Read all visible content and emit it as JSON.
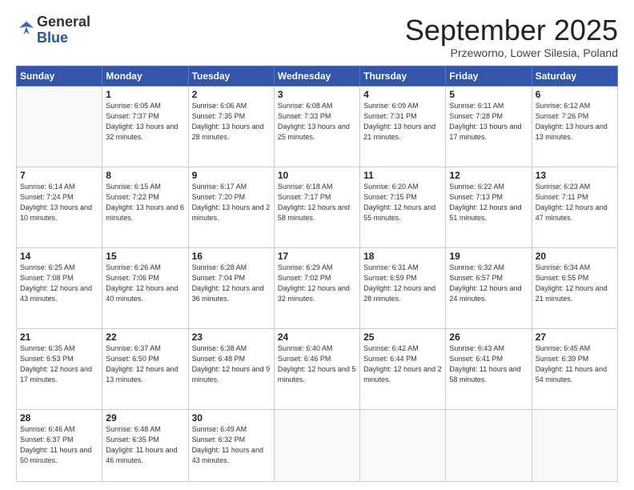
{
  "logo": {
    "general": "General",
    "blue": "Blue"
  },
  "header": {
    "month": "September 2025",
    "location": "Przeworno, Lower Silesia, Poland"
  },
  "weekdays": [
    "Sunday",
    "Monday",
    "Tuesday",
    "Wednesday",
    "Thursday",
    "Friday",
    "Saturday"
  ],
  "weeks": [
    [
      {
        "day": "",
        "sunrise": "",
        "sunset": "",
        "daylight": ""
      },
      {
        "day": "1",
        "sunrise": "Sunrise: 6:05 AM",
        "sunset": "Sunset: 7:37 PM",
        "daylight": "Daylight: 13 hours and 32 minutes."
      },
      {
        "day": "2",
        "sunrise": "Sunrise: 6:06 AM",
        "sunset": "Sunset: 7:35 PM",
        "daylight": "Daylight: 13 hours and 28 minutes."
      },
      {
        "day": "3",
        "sunrise": "Sunrise: 6:08 AM",
        "sunset": "Sunset: 7:33 PM",
        "daylight": "Daylight: 13 hours and 25 minutes."
      },
      {
        "day": "4",
        "sunrise": "Sunrise: 6:09 AM",
        "sunset": "Sunset: 7:31 PM",
        "daylight": "Daylight: 13 hours and 21 minutes."
      },
      {
        "day": "5",
        "sunrise": "Sunrise: 6:11 AM",
        "sunset": "Sunset: 7:28 PM",
        "daylight": "Daylight: 13 hours and 17 minutes."
      },
      {
        "day": "6",
        "sunrise": "Sunrise: 6:12 AM",
        "sunset": "Sunset: 7:26 PM",
        "daylight": "Daylight: 13 hours and 13 minutes."
      }
    ],
    [
      {
        "day": "7",
        "sunrise": "Sunrise: 6:14 AM",
        "sunset": "Sunset: 7:24 PM",
        "daylight": "Daylight: 13 hours and 10 minutes."
      },
      {
        "day": "8",
        "sunrise": "Sunrise: 6:15 AM",
        "sunset": "Sunset: 7:22 PM",
        "daylight": "Daylight: 13 hours and 6 minutes."
      },
      {
        "day": "9",
        "sunrise": "Sunrise: 6:17 AM",
        "sunset": "Sunset: 7:20 PM",
        "daylight": "Daylight: 13 hours and 2 minutes."
      },
      {
        "day": "10",
        "sunrise": "Sunrise: 6:18 AM",
        "sunset": "Sunset: 7:17 PM",
        "daylight": "Daylight: 12 hours and 58 minutes."
      },
      {
        "day": "11",
        "sunrise": "Sunrise: 6:20 AM",
        "sunset": "Sunset: 7:15 PM",
        "daylight": "Daylight: 12 hours and 55 minutes."
      },
      {
        "day": "12",
        "sunrise": "Sunrise: 6:22 AM",
        "sunset": "Sunset: 7:13 PM",
        "daylight": "Daylight: 12 hours and 51 minutes."
      },
      {
        "day": "13",
        "sunrise": "Sunrise: 6:23 AM",
        "sunset": "Sunset: 7:11 PM",
        "daylight": "Daylight: 12 hours and 47 minutes."
      }
    ],
    [
      {
        "day": "14",
        "sunrise": "Sunrise: 6:25 AM",
        "sunset": "Sunset: 7:08 PM",
        "daylight": "Daylight: 12 hours and 43 minutes."
      },
      {
        "day": "15",
        "sunrise": "Sunrise: 6:26 AM",
        "sunset": "Sunset: 7:06 PM",
        "daylight": "Daylight: 12 hours and 40 minutes."
      },
      {
        "day": "16",
        "sunrise": "Sunrise: 6:28 AM",
        "sunset": "Sunset: 7:04 PM",
        "daylight": "Daylight: 12 hours and 36 minutes."
      },
      {
        "day": "17",
        "sunrise": "Sunrise: 6:29 AM",
        "sunset": "Sunset: 7:02 PM",
        "daylight": "Daylight: 12 hours and 32 minutes."
      },
      {
        "day": "18",
        "sunrise": "Sunrise: 6:31 AM",
        "sunset": "Sunset: 6:59 PM",
        "daylight": "Daylight: 12 hours and 28 minutes."
      },
      {
        "day": "19",
        "sunrise": "Sunrise: 6:32 AM",
        "sunset": "Sunset: 6:57 PM",
        "daylight": "Daylight: 12 hours and 24 minutes."
      },
      {
        "day": "20",
        "sunrise": "Sunrise: 6:34 AM",
        "sunset": "Sunset: 6:55 PM",
        "daylight": "Daylight: 12 hours and 21 minutes."
      }
    ],
    [
      {
        "day": "21",
        "sunrise": "Sunrise: 6:35 AM",
        "sunset": "Sunset: 6:53 PM",
        "daylight": "Daylight: 12 hours and 17 minutes."
      },
      {
        "day": "22",
        "sunrise": "Sunrise: 6:37 AM",
        "sunset": "Sunset: 6:50 PM",
        "daylight": "Daylight: 12 hours and 13 minutes."
      },
      {
        "day": "23",
        "sunrise": "Sunrise: 6:38 AM",
        "sunset": "Sunset: 6:48 PM",
        "daylight": "Daylight: 12 hours and 9 minutes."
      },
      {
        "day": "24",
        "sunrise": "Sunrise: 6:40 AM",
        "sunset": "Sunset: 6:46 PM",
        "daylight": "Daylight: 12 hours and 5 minutes."
      },
      {
        "day": "25",
        "sunrise": "Sunrise: 6:42 AM",
        "sunset": "Sunset: 6:44 PM",
        "daylight": "Daylight: 12 hours and 2 minutes."
      },
      {
        "day": "26",
        "sunrise": "Sunrise: 6:43 AM",
        "sunset": "Sunset: 6:41 PM",
        "daylight": "Daylight: 11 hours and 58 minutes."
      },
      {
        "day": "27",
        "sunrise": "Sunrise: 6:45 AM",
        "sunset": "Sunset: 6:39 PM",
        "daylight": "Daylight: 11 hours and 54 minutes."
      }
    ],
    [
      {
        "day": "28",
        "sunrise": "Sunrise: 6:46 AM",
        "sunset": "Sunset: 6:37 PM",
        "daylight": "Daylight: 11 hours and 50 minutes."
      },
      {
        "day": "29",
        "sunrise": "Sunrise: 6:48 AM",
        "sunset": "Sunset: 6:35 PM",
        "daylight": "Daylight: 11 hours and 46 minutes."
      },
      {
        "day": "30",
        "sunrise": "Sunrise: 6:49 AM",
        "sunset": "Sunset: 6:32 PM",
        "daylight": "Daylight: 11 hours and 43 minutes."
      },
      {
        "day": "",
        "sunrise": "",
        "sunset": "",
        "daylight": ""
      },
      {
        "day": "",
        "sunrise": "",
        "sunset": "",
        "daylight": ""
      },
      {
        "day": "",
        "sunrise": "",
        "sunset": "",
        "daylight": ""
      },
      {
        "day": "",
        "sunrise": "",
        "sunset": "",
        "daylight": ""
      }
    ]
  ]
}
